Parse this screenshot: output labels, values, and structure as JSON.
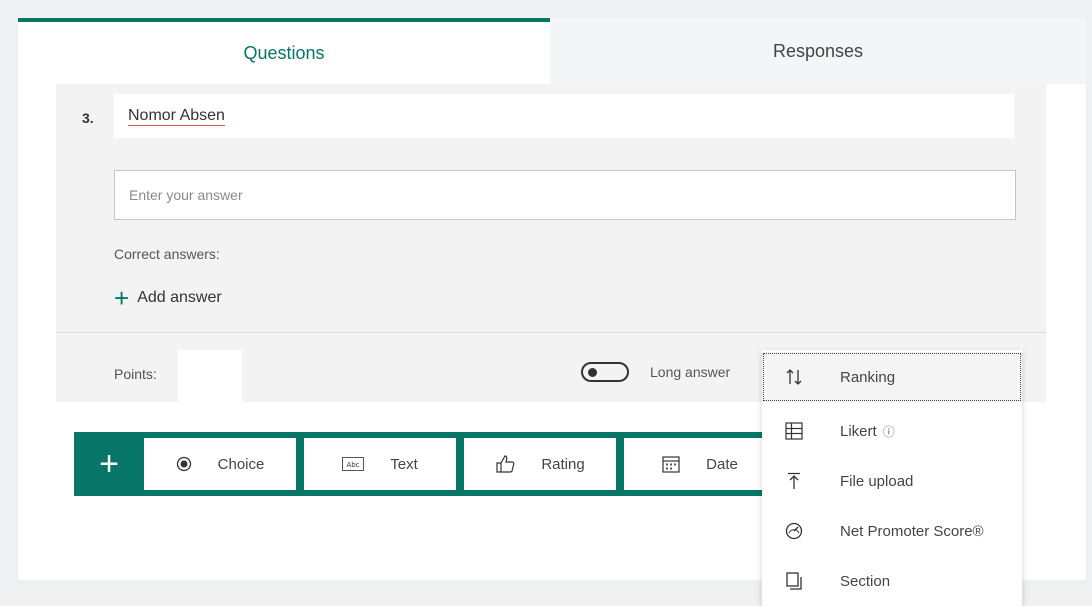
{
  "tabs": {
    "questions": "Questions",
    "responses": "Responses"
  },
  "question": {
    "number": "3.",
    "title": "Nomor Absen",
    "answer_placeholder": "Enter your answer",
    "correct_answers_label": "Correct answers:",
    "add_answer_label": "Add answer",
    "points_label": "Points:",
    "points_value": "",
    "long_answer_label": "Long answer",
    "long_answer_on": false
  },
  "type_bar": {
    "add_icon": "plus-icon",
    "buttons": [
      {
        "label": "Choice",
        "icon": "radio-icon"
      },
      {
        "label": "Text",
        "icon": "text-box-icon"
      },
      {
        "label": "Rating",
        "icon": "thumbs-up-icon"
      },
      {
        "label": "Date",
        "icon": "calendar-icon"
      }
    ]
  },
  "more_menu": {
    "items": [
      {
        "label": "Ranking",
        "icon": "sort-arrows-icon",
        "active": true
      },
      {
        "label": "Likert",
        "icon": "grid-icon",
        "info_icon": "info-icon"
      },
      {
        "label": "File upload",
        "icon": "upload-icon"
      },
      {
        "label": "Net Promoter Score®",
        "icon": "gauge-icon"
      },
      {
        "label": "Section",
        "icon": "section-icon"
      }
    ]
  },
  "colors": {
    "accent": "#077568",
    "background": "#eef0f1"
  }
}
